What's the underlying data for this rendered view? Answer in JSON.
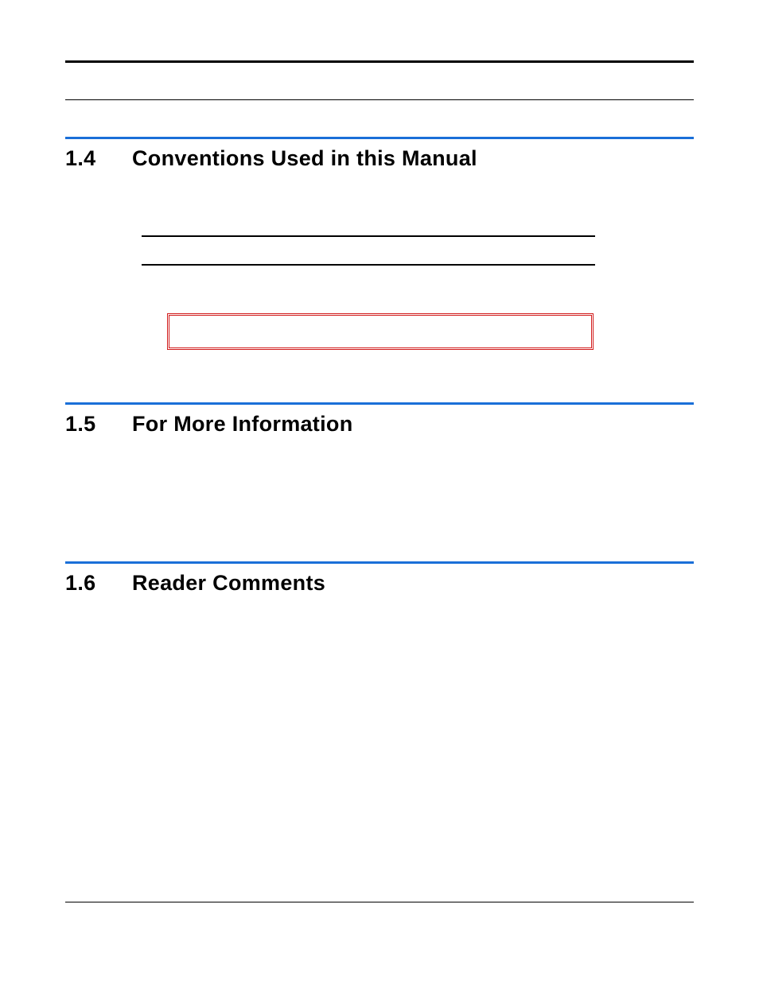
{
  "sections": {
    "s1": {
      "number": "1.4",
      "title": "Conventions Used in this Manual"
    },
    "s2": {
      "number": "1.5",
      "title": "For More Information"
    },
    "s3": {
      "number": "1.6",
      "title": "Reader Comments"
    }
  }
}
